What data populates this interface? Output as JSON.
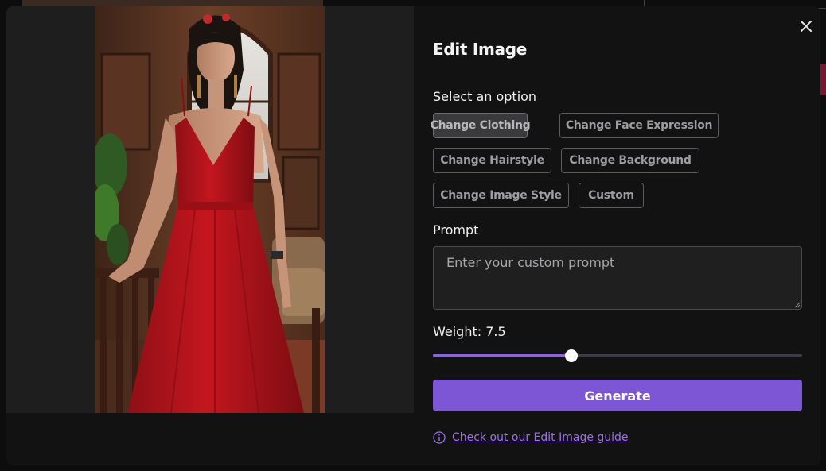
{
  "modal": {
    "title": "Edit Image",
    "close_icon": "close-icon"
  },
  "options": {
    "label": "Select an option",
    "items": [
      {
        "label": "Change Clothing",
        "selected": true
      },
      {
        "label": "Change Face Expression",
        "selected": false
      },
      {
        "label": "Change Hairstyle",
        "selected": false
      },
      {
        "label": "Change Background",
        "selected": false
      },
      {
        "label": "Change Image Style",
        "selected": false
      },
      {
        "label": "Custom",
        "selected": false
      }
    ]
  },
  "prompt": {
    "label": "Prompt",
    "placeholder": "Enter your custom prompt",
    "value": ""
  },
  "weight": {
    "label": "Weight: 7.5",
    "value": 7.5,
    "min": 0,
    "max": 20
  },
  "generate": {
    "label": "Generate"
  },
  "guide": {
    "icon": "info-icon",
    "link_text": "Check out our Edit Image guide"
  },
  "colors": {
    "accent": "#7c56d4",
    "slider_fill": "#8b63d8",
    "link": "#9b72e6",
    "dress": "#b3141c"
  },
  "image": {
    "subject": "woman in red dress",
    "icon": "photo-preview"
  }
}
